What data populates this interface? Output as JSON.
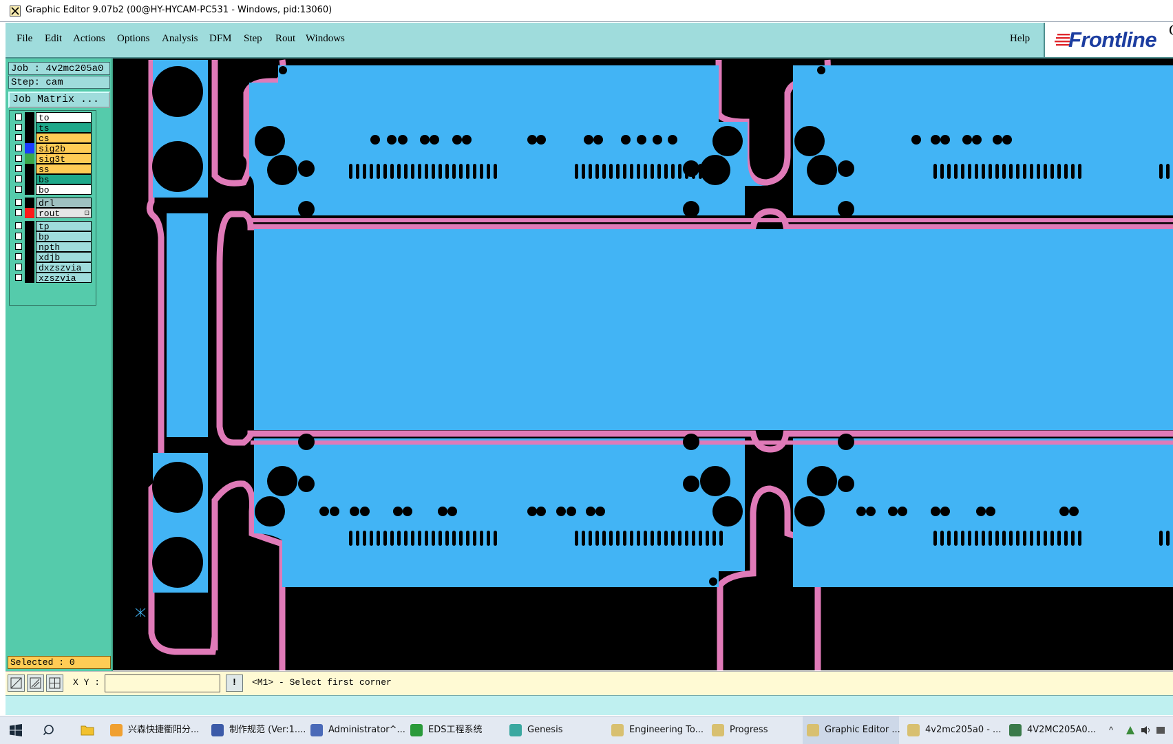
{
  "window": {
    "title": "Graphic Editor 9.07b2 (00@HY-HYCAM-PC531 - Windows, pid:13060)"
  },
  "menu": {
    "items": [
      "File",
      "Edit",
      "Actions",
      "Options",
      "Analysis",
      "DFM",
      "Step",
      "Rout",
      "Windows"
    ],
    "help": "Help",
    "logo": "Frontline",
    "logo_suffix": "G"
  },
  "job": {
    "job_label": "Job : 4v2mc205a0",
    "step_label": "Step: cam",
    "matrix_button": "Job Matrix ..."
  },
  "layers": [
    {
      "name": "to",
      "color": "#ffffff",
      "swatch": "#000000"
    },
    {
      "name": "ts",
      "color": "#1ea88a",
      "swatch": "#000000"
    },
    {
      "name": "cs",
      "color": "#ffcc55",
      "swatch": "#000000"
    },
    {
      "name": "sig2b",
      "color": "#ffcc55",
      "swatch": "#1a3cff"
    },
    {
      "name": "sig3t",
      "color": "#ffcc55",
      "swatch": "#3aa84a"
    },
    {
      "name": "ss",
      "color": "#ffcc55",
      "swatch": "#000000"
    },
    {
      "name": "bs",
      "color": "#1ea88a",
      "swatch": "#000000"
    },
    {
      "name": "bo",
      "color": "#ffffff",
      "swatch": "#000000"
    },
    {
      "name": "drl",
      "color": "#9fc0c0",
      "swatch": "#000000"
    },
    {
      "name": "rout",
      "color": "#e6e6e6",
      "swatch": "#ff1a1a",
      "mark": "⊡"
    },
    {
      "name": "tp",
      "color": "#9fdcdc",
      "swatch": "#000000"
    },
    {
      "name": "bp",
      "color": "#9fdcdc",
      "swatch": "#000000"
    },
    {
      "name": "npth",
      "color": "#9fdcdc",
      "swatch": "#000000"
    },
    {
      "name": "xdjb",
      "color": "#9fdcdc",
      "swatch": "#000000"
    },
    {
      "name": "dxzszvia",
      "color": "#9fdcdc",
      "swatch": "#000000"
    },
    {
      "name": "xzszvia",
      "color": "#9fdcdc",
      "swatch": "#000000"
    }
  ],
  "selected_label": "Selected : 0",
  "status": {
    "xy_label": "X Y :",
    "xy_value": "",
    "bang": "!",
    "prompt": "<M1> - Select first corner"
  },
  "colors": {
    "board": "#42b4f5",
    "outline": "#e07ab8",
    "background": "#000000",
    "panel": "#55cbab",
    "menubar": "#9fdcdc"
  },
  "taskbar": {
    "items": [
      {
        "label": "兴森快捷衢阳分...",
        "icon": "sun-icon"
      },
      {
        "label": "制作规范 (Ver:1....",
        "icon": "document-icon"
      },
      {
        "label": "Administrator^...",
        "icon": "disk-icon"
      },
      {
        "label": "EDS工程系统",
        "icon": "f-icon"
      },
      {
        "label": "Genesis",
        "icon": "genesis-icon"
      },
      {
        "label": "Engineering To...",
        "icon": "x-window-icon"
      },
      {
        "label": "Progress",
        "icon": "x-window-icon"
      },
      {
        "label": "Graphic Editor ...",
        "icon": "x-window-icon",
        "active": true
      },
      {
        "label": "4v2mc205a0 - ...",
        "icon": "x-window-icon"
      },
      {
        "label": "4V2MC205A0...",
        "icon": "spreadsheet-icon"
      }
    ],
    "tray": "^"
  }
}
